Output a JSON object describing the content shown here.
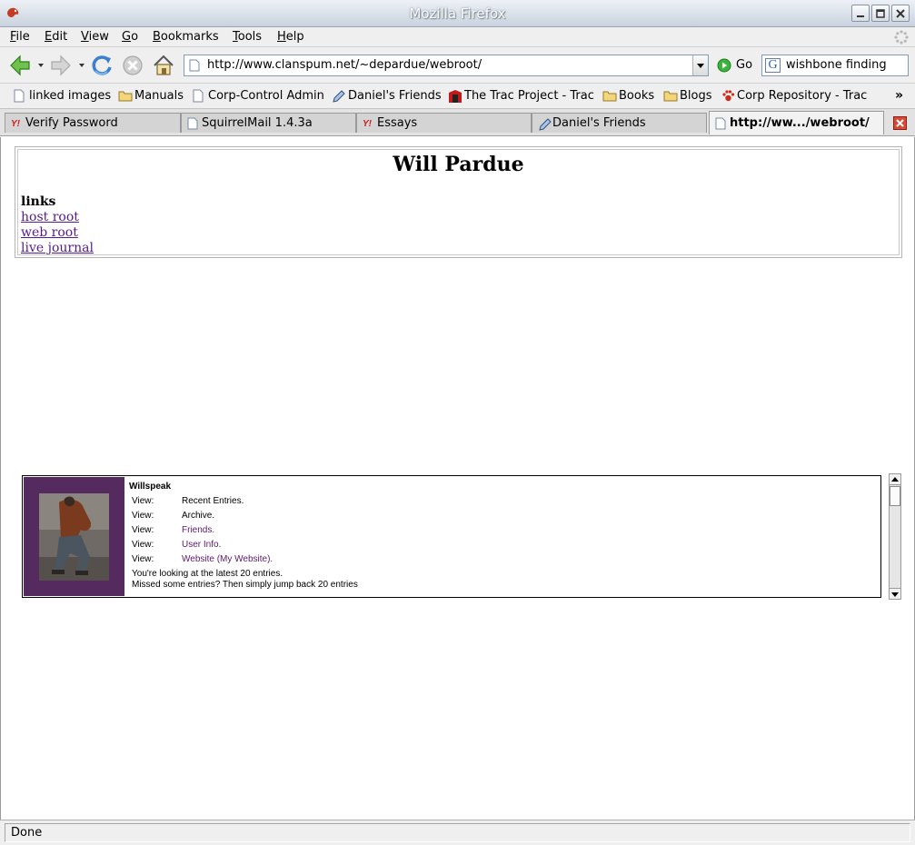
{
  "window": {
    "title": "Mozilla Firefox"
  },
  "menu": {
    "file": "File",
    "file_key": "F",
    "edit": "Edit",
    "edit_key": "E",
    "view": "View",
    "view_key": "V",
    "go": "Go",
    "go_key": "G",
    "bookmarks": "Bookmarks",
    "bookmarks_key": "B",
    "tools": "Tools",
    "tools_key": "T",
    "help": "Help",
    "help_key": "H"
  },
  "navbar": {
    "url": "http://www.clanspum.net/~depardue/webroot/",
    "go_label": "Go",
    "search_value": "wishbone finding"
  },
  "bookmarks": [
    {
      "label": "linked images",
      "icon": "page-icon"
    },
    {
      "label": "Manuals",
      "icon": "folder-icon"
    },
    {
      "label": "Corp-Control Admin",
      "icon": "page-icon"
    },
    {
      "label": "Daniel's Friends",
      "icon": "pencil-icon"
    },
    {
      "label": "The Trac Project - Trac",
      "icon": "trac-icon"
    },
    {
      "label": "Books",
      "icon": "folder-icon"
    },
    {
      "label": "Blogs",
      "icon": "folder-icon"
    },
    {
      "label": "Corp Repository - Trac",
      "icon": "paw-icon"
    }
  ],
  "bookmarks_overflow": "»",
  "tabs": [
    {
      "label": "Verify Password",
      "icon": "yahoo-icon"
    },
    {
      "label": "SquirrelMail 1.4.3a",
      "icon": "page-icon"
    },
    {
      "label": "Essays",
      "icon": "yahoo-icon"
    },
    {
      "label": "Daniel's Friends",
      "icon": "pencil-icon"
    },
    {
      "label": "http://ww.../webroot/",
      "icon": "page-icon",
      "active": true
    }
  ],
  "page": {
    "title": "Will Pardue",
    "links_heading": "links",
    "links": [
      "host root",
      "web root",
      "live journal"
    ]
  },
  "journal": {
    "title": "Willspeak",
    "rows": [
      {
        "key": "View:",
        "value": "Recent Entries."
      },
      {
        "key": "View:",
        "value": "Archive."
      },
      {
        "key": "View:",
        "value": "Friends."
      },
      {
        "key": "View:",
        "value": "User Info."
      },
      {
        "key": "View:",
        "value": "Website (My Website)."
      }
    ],
    "note1": "You're looking at the latest 20 entries.",
    "note2": "Missed some entries? Then simply jump back 20 entries",
    "panel_color": "#552a5e"
  },
  "status": {
    "text": "Done"
  }
}
